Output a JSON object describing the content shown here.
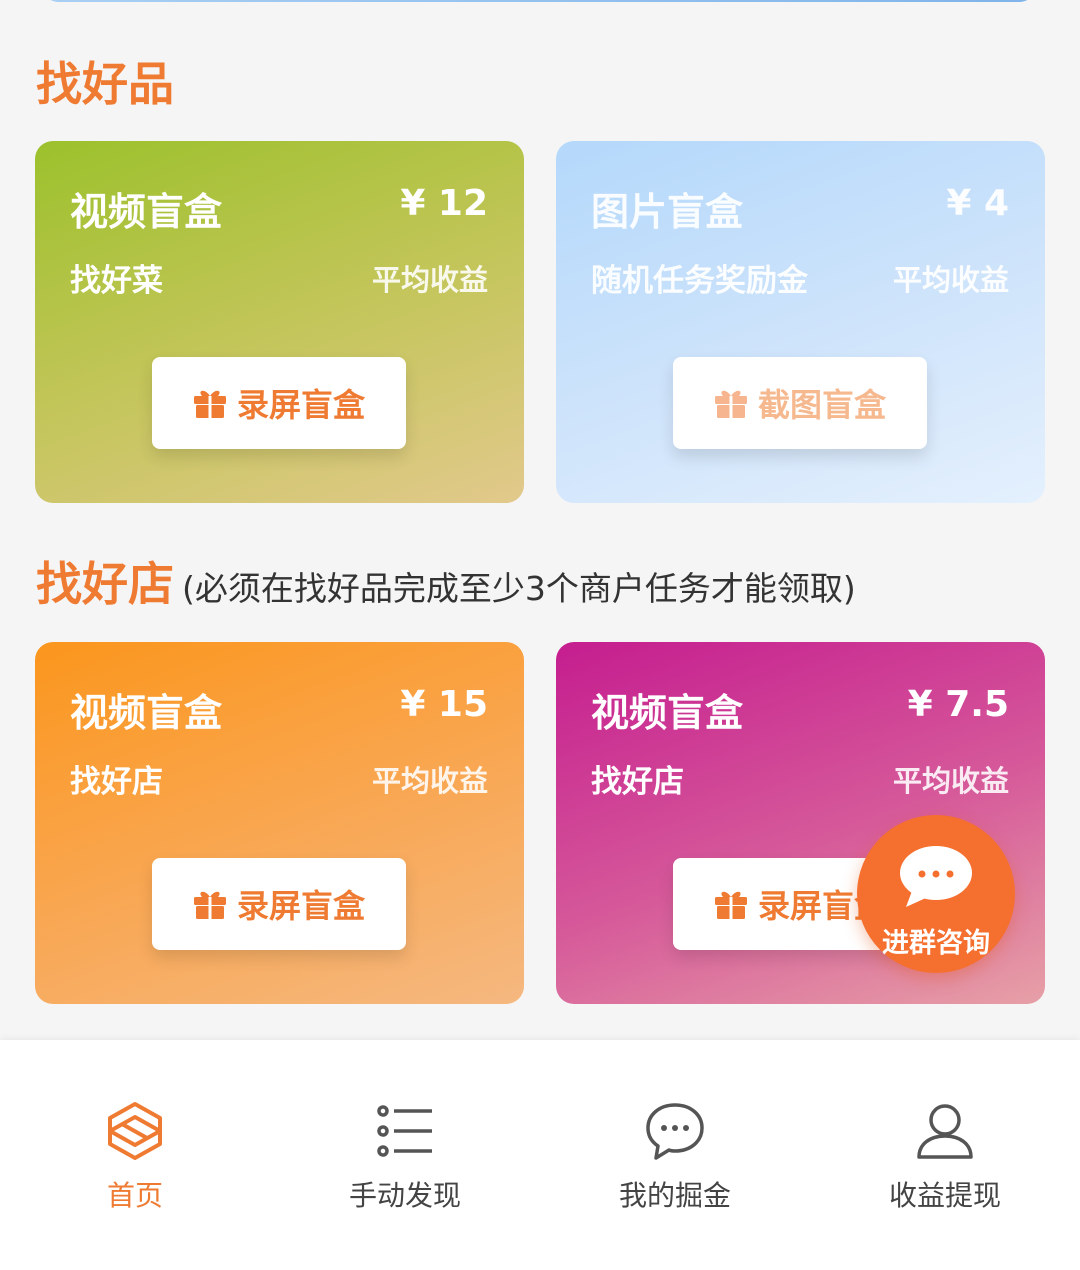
{
  "section1": {
    "title": "找好品"
  },
  "section2": {
    "title": "找好店",
    "note": "(必须在找好品完成至少3个商户任务才能领取)"
  },
  "cards": [
    {
      "title": "视频盲盒",
      "price": "¥ 12",
      "subtitle": "找好菜",
      "avg_label": "平均收益",
      "button": "录屏盲盒"
    },
    {
      "title": "图片盲盒",
      "price": "¥ 4",
      "subtitle": "随机任务奖励金",
      "avg_label": "平均收益",
      "button": "截图盲盒"
    },
    {
      "title": "视频盲盒",
      "price": "¥ 15",
      "subtitle": "找好店",
      "avg_label": "平均收益",
      "button": "录屏盲盒"
    },
    {
      "title": "视频盲盒",
      "price": "¥ 7.5",
      "subtitle": "找好店",
      "avg_label": "平均收益",
      "button": "录屏盲盒"
    }
  ],
  "consult": {
    "label": "进群咨询",
    "icon": "chat-bubble-icon"
  },
  "tabs": [
    {
      "label": "首页",
      "icon": "cube-icon",
      "active": true
    },
    {
      "label": "手动发现",
      "icon": "list-icon",
      "active": false
    },
    {
      "label": "我的掘金",
      "icon": "chat-icon",
      "active": false
    },
    {
      "label": "收益提现",
      "icon": "user-icon",
      "active": false
    }
  ],
  "colors": {
    "accent": "#ef7a32",
    "fab": "#f56f2f"
  }
}
